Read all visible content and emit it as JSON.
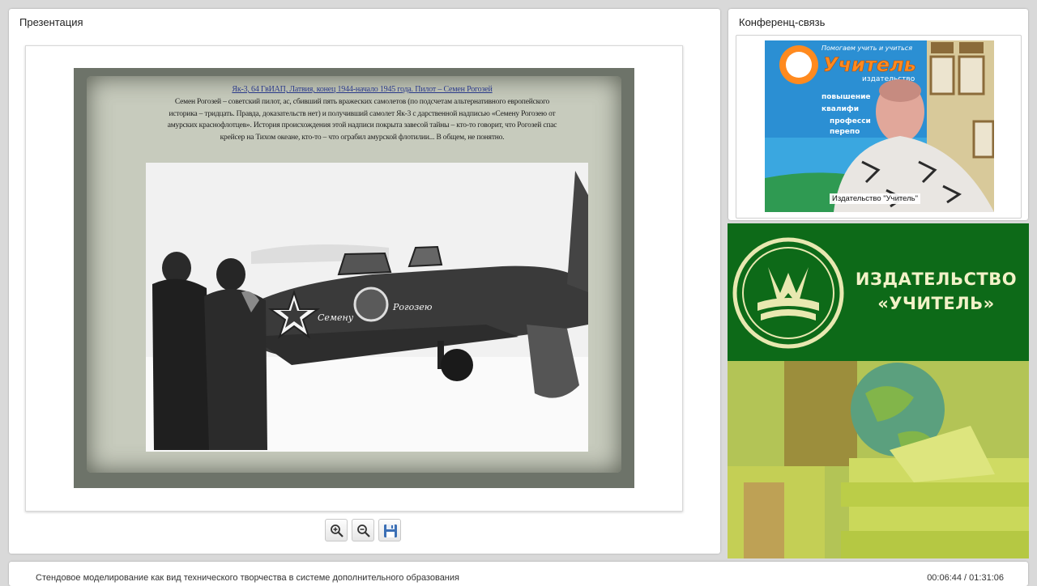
{
  "presentation": {
    "title": "Презентация",
    "slide": {
      "heading": "Як-3, 64 ГвИАП, Латвия, конец 1944-начало 1945 года. Пилот – Семен Рогозей",
      "body_lines": [
        "Семен Рогозей – советский пилот, ас, сбивший пять вражеских самолетов (по подсчетам альтернативного европейского",
        "историка – тридцать. Правда, доказательств нет) и получивший самолет Як-3 с дарственной надписью «Семену Рогозею от",
        "амурских краснофлотцев». История происхождения этой надписи покрыта завесой тайны – кто-то говорит, что Рогозей спас",
        "крейсер на Тихом океане, кто-то – что ограбил амурской флотилии... В общем, не понятно."
      ],
      "photo_inscriptions": [
        "Семену",
        "Рогозею"
      ]
    },
    "toolbar": {
      "zoom_in_icon": "zoom-in-icon",
      "zoom_out_icon": "zoom-out-icon",
      "save_icon": "save-icon"
    }
  },
  "conference": {
    "title": "Конференц-связь",
    "participant_label": "Издательство \"Учитель\"",
    "poster_lines": [
      "Помогаем учить и учиться",
      "Учитель",
      "издательство",
      "повышение",
      "квалифи",
      "професси",
      "перепо"
    ]
  },
  "banner": {
    "line1": "ИЗДАТЕЛЬСТВО",
    "line2": "«УЧИТЕЛЬ»",
    "colors": {
      "green": "#0d6a18",
      "text": "#f2f2c8"
    }
  },
  "footer": {
    "course_title": "Стендовое моделирование как вид технического творчества в системе дополнительного образования",
    "time": "00:06:44 / 01:31:06"
  }
}
